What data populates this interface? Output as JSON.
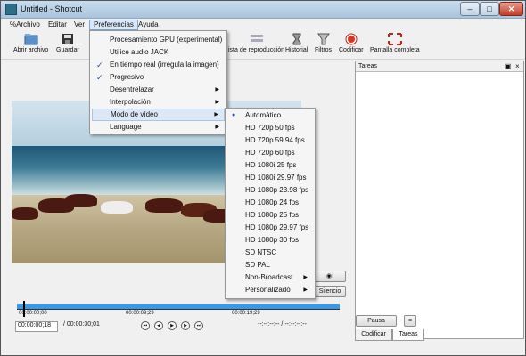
{
  "window": {
    "title": "Untitled - Shotcut",
    "min": "–",
    "max": "□",
    "close": "✕"
  },
  "menubar": [
    "%Archivo",
    "Editar",
    "Ver",
    "Preferencias",
    "Ayuda"
  ],
  "toolbar": {
    "open": "Abrir archivo",
    "save": "Guardar",
    "playlist": "ista de reproducción",
    "history": "Historial",
    "filters": "Filtros",
    "encode": "Codificar",
    "fullscreen": "Pantalla completa"
  },
  "prefs_menu": [
    {
      "label": "Procesamiento GPU (experimental)",
      "checked": false
    },
    {
      "label": "Utilice audio JACK",
      "checked": false
    },
    {
      "label": "En tiempo real (irregula la imagen)",
      "checked": true
    },
    {
      "label": "Progresivo",
      "checked": true
    },
    {
      "label": "Desentrelazar",
      "submenu": true
    },
    {
      "label": "Interpolación",
      "submenu": true
    },
    {
      "label": "Modo de vídeo",
      "submenu": true
    },
    {
      "label": "Language",
      "submenu": true
    }
  ],
  "video_mode_menu": [
    "Automático",
    "HD 720p 50 fps",
    "HD 720p 59.94 fps",
    "HD 720p 60 fps",
    "HD 1080i 25 fps",
    "HD 1080i 29.97 fps",
    "HD 1080p 23.98 fps",
    "HD 1080p 24 fps",
    "HD 1080p 25 fps",
    "HD 1080p 29.97 fps",
    "HD 1080p 30 fps",
    "SD NTSC",
    "SD PAL",
    "Non-Broadcast",
    "Personalizado"
  ],
  "tasks_panel": {
    "title": "Tareas",
    "pause": "Pausa"
  },
  "bottom_tabs": {
    "encode": "Codificar",
    "tasks": "Tareas"
  },
  "player": {
    "silence_btn": "Silencio",
    "timeline_marks": [
      "00:00:00;00",
      "00:00:09;29",
      "00:00:19;29"
    ],
    "position": "00:00:00;18",
    "duration": "/ 00:00:30;01",
    "in_out": "--:--:--:-- / --:--:--:--"
  },
  "colors": {
    "accent": "#3a99e6",
    "menu_hover": "#dce8f6"
  }
}
